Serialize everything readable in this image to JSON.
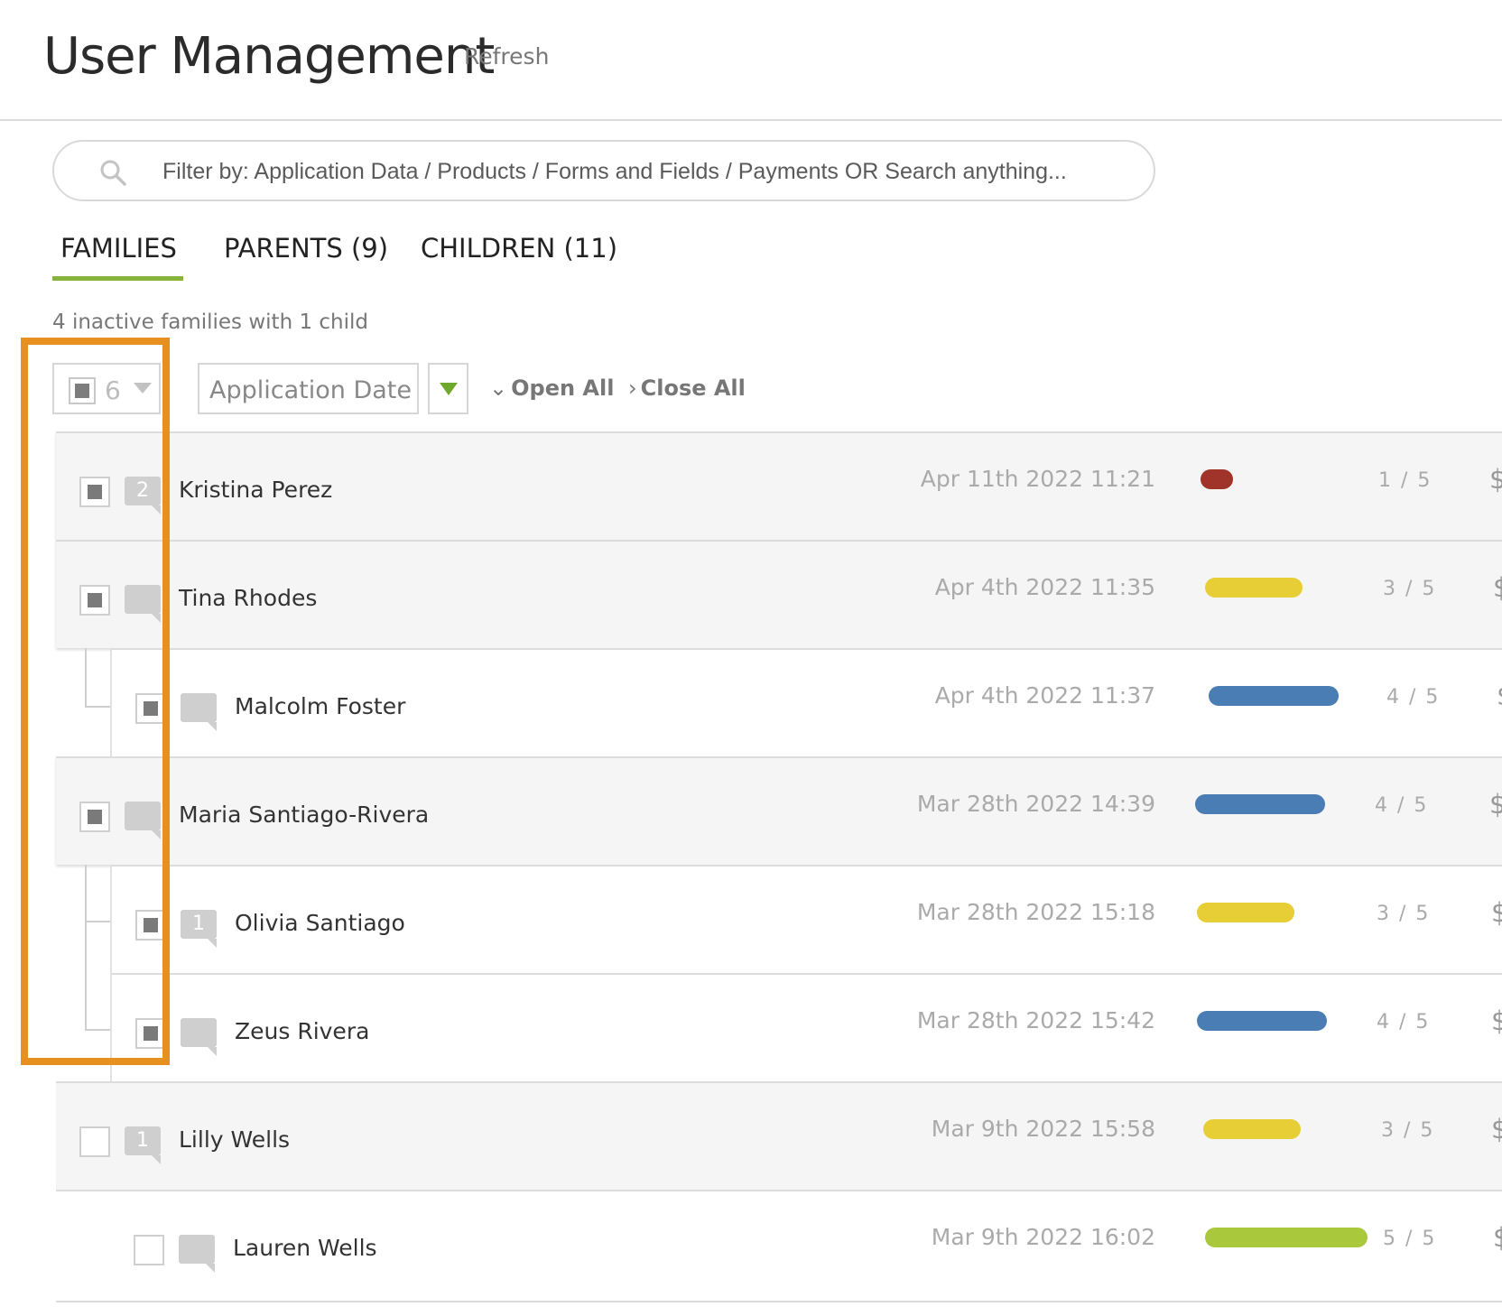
{
  "header": {
    "title": "User Management",
    "refresh_label": "Refresh"
  },
  "search": {
    "placeholder": "Filter by: Application Data / Products / Forms and Fields / Payments OR Search anything..."
  },
  "tabs": [
    {
      "label": "FAMILIES",
      "active": true
    },
    {
      "label": "PARENTS (9)",
      "active": false
    },
    {
      "label": "CHILDREN (11)",
      "active": false
    }
  ],
  "summary": "4 inactive families with 1 child",
  "toolbar": {
    "selected_count": "6",
    "sort_field": "Application Date",
    "open_all": "Open All",
    "close_all": "Close All"
  },
  "rows": [
    {
      "type": "parent",
      "name": "Kristina Perez",
      "checked": true,
      "comments": "2",
      "date": "Apr 11th 2022 11:21",
      "progress": "1 / 5",
      "bar_color": "#a0342a",
      "currency": "$"
    },
    {
      "type": "parent",
      "name": "Tina Rhodes",
      "checked": true,
      "comments": "",
      "date": "Apr 4th 2022 11:35",
      "progress": "3 / 5",
      "bar_color": "#e8ce36",
      "currency": "$"
    },
    {
      "type": "child",
      "name": "Malcolm Foster",
      "checked": true,
      "comments": "",
      "date": "Apr 4th 2022 11:37",
      "progress": "4 / 5",
      "bar_color": "#4a7db3",
      "currency": "$"
    },
    {
      "type": "parent",
      "name": "Maria Santiago-Rivera",
      "checked": true,
      "comments": "",
      "date": "Mar 28th 2022 14:39",
      "progress": "4 / 5",
      "bar_color": "#4a7db3",
      "currency": "$"
    },
    {
      "type": "child",
      "name": "Olivia Santiago",
      "checked": true,
      "comments": "1",
      "date": "Mar 28th 2022 15:18",
      "progress": "3 / 5",
      "bar_color": "#e8ce36",
      "currency": "$"
    },
    {
      "type": "child",
      "name": "Zeus Rivera",
      "checked": true,
      "comments": "",
      "date": "Mar 28th 2022 15:42",
      "progress": "4 / 5",
      "bar_color": "#4a7db3",
      "currency": "$"
    },
    {
      "type": "parent",
      "name": "Lilly Wells",
      "checked": false,
      "comments": "1",
      "date": "Mar 9th 2022 15:58",
      "progress": "3 / 5",
      "bar_color": "#e8ce36",
      "currency": "$"
    },
    {
      "type": "child",
      "name": "Lauren Wells",
      "checked": false,
      "comments": "",
      "date": "Mar 9th 2022 16:02",
      "progress": "5 / 5",
      "bar_color": "#aac83c",
      "currency": "$"
    }
  ]
}
